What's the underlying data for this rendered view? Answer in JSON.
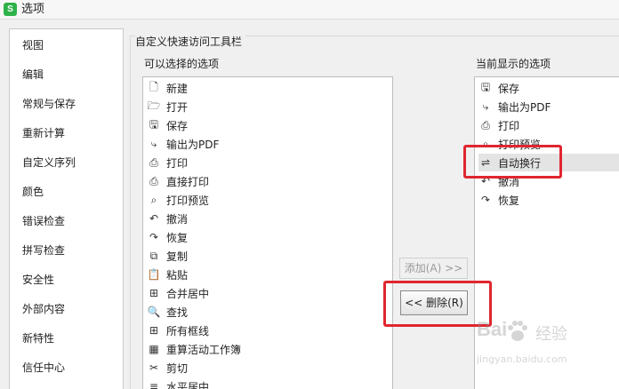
{
  "window": {
    "title": "选项",
    "app_icon_letter": "S"
  },
  "categories": [
    "视图",
    "编辑",
    "常规与保存",
    "重新计算",
    "自定义序列",
    "颜色",
    "错误检查",
    "拼写检查",
    "安全性",
    "外部内容",
    "新特性",
    "信任中心"
  ],
  "group": {
    "title": "自定义快速访问工具栏",
    "available_label": "可以选择的选项",
    "current_label": "当前显示的选项"
  },
  "available": [
    {
      "icon": "new-doc-icon",
      "label": "新建"
    },
    {
      "icon": "open-folder-icon",
      "label": "打开"
    },
    {
      "icon": "save-icon",
      "label": "保存"
    },
    {
      "icon": "export-pdf-icon",
      "label": "输出为PDF"
    },
    {
      "icon": "print-icon",
      "label": "打印"
    },
    {
      "icon": "direct-print-icon",
      "label": "直接打印"
    },
    {
      "icon": "print-preview-icon",
      "label": "打印预览"
    },
    {
      "icon": "undo-icon",
      "label": "撤消"
    },
    {
      "icon": "redo-icon",
      "label": "恢复"
    },
    {
      "icon": "copy-icon",
      "label": "复制"
    },
    {
      "icon": "paste-icon",
      "label": "粘贴"
    },
    {
      "icon": "merge-center-icon",
      "label": "合并居中"
    },
    {
      "icon": "find-icon",
      "label": "查找"
    },
    {
      "icon": "all-borders-icon",
      "label": "所有框线"
    },
    {
      "icon": "recalc-icon",
      "label": "重算活动工作簿"
    },
    {
      "icon": "cut-icon",
      "label": "剪切"
    },
    {
      "icon": "align-center-icon",
      "label": "水平居中"
    }
  ],
  "current": [
    {
      "icon": "save-icon",
      "label": "保存"
    },
    {
      "icon": "export-pdf-icon",
      "label": "输出为PDF"
    },
    {
      "icon": "print-icon",
      "label": "打印"
    },
    {
      "icon": "print-preview-icon",
      "label": "打印预览"
    },
    {
      "icon": "wrap-text-icon",
      "label": "自动换行",
      "selected": true
    },
    {
      "icon": "undo-icon",
      "label": "撤消"
    },
    {
      "icon": "redo-icon",
      "label": "恢复"
    }
  ],
  "buttons": {
    "add": "添加(A) >>",
    "remove": "<< 删除(R)"
  },
  "watermark": {
    "brand": "Bai",
    "suffix": "经验",
    "url": "jingyan.baidu.com"
  },
  "colors": {
    "highlight": "#e0262f",
    "app_green": "#2fb24a"
  }
}
